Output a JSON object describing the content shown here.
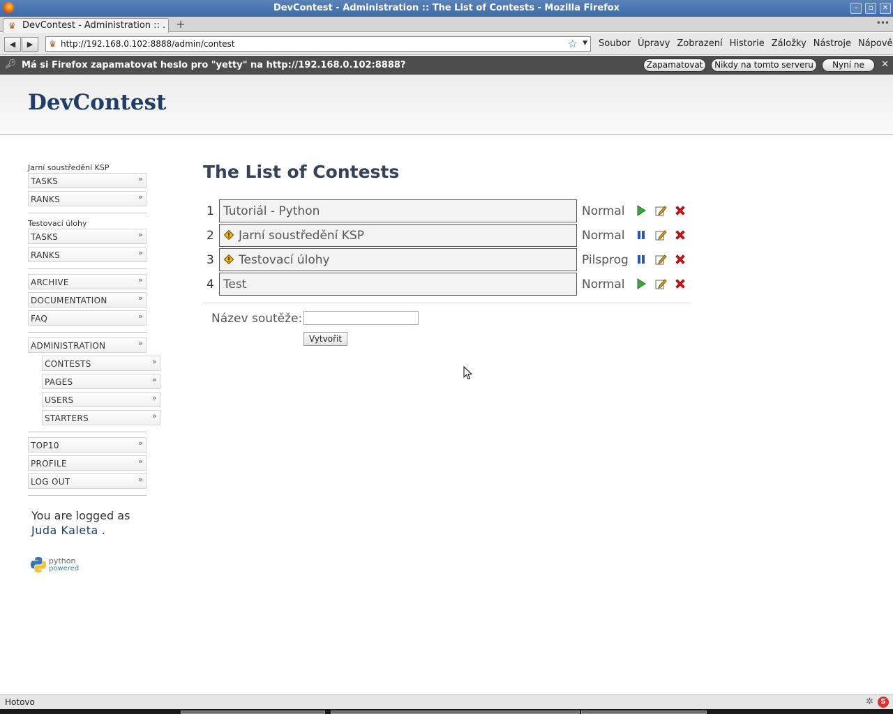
{
  "window": {
    "title": "DevContest - Administration :: The List of Contests - Mozilla Firefox",
    "buttons": [
      "–",
      "▫",
      "✕"
    ]
  },
  "tabs": {
    "active_label": "DevContest - Administration :: ...",
    "new_tab": "+",
    "list_icon": "•••"
  },
  "navbar": {
    "back_icon": "back-arrow-icon",
    "forward_icon": "forward-arrow-icon",
    "back": "◀",
    "forward": "▶",
    "url": "http://192.168.0.102:8888/admin/contest",
    "bookmark_star": "☆",
    "dropdown": "▼",
    "menu": [
      "Soubor",
      "Úpravy",
      "Zobrazení",
      "Historie",
      "Záložky",
      "Nástroje",
      "Nápověda"
    ]
  },
  "notification": {
    "message": "Má si Firefox zapamatovat heslo pro \"yetty\" na http://192.168.0.102:8888?",
    "remember": "Zapamatovat",
    "never": "Nikdy na tomto serveru",
    "not_now": "Nyní ne",
    "close": "✕"
  },
  "header": {
    "logo": "DevContest"
  },
  "sidebar": {
    "group1_title": "Jarní soustředění KSP",
    "group1_items": [
      "TASKS",
      "RANKS"
    ],
    "group2_title": "Testovací úlohy",
    "group2_items": [
      "TASKS",
      "RANKS"
    ],
    "group3_items": [
      "ARCHIVE",
      "DOCUMENTATION",
      "FAQ"
    ],
    "admin_item": "ADMINISTRATION",
    "admin_subitems": [
      "CONTESTS",
      "PAGES",
      "USERS",
      "STARTERS"
    ],
    "group5_items": [
      "TOP10",
      "PROFILE",
      "LOG OUT"
    ],
    "chevron": "»",
    "logged_text": "You are logged as",
    "logged_user": "Juda Kaleta",
    "logged_end": " .",
    "python_text1": "python",
    "python_text2": "powered"
  },
  "main": {
    "title": "The List of Contests",
    "contests": [
      {
        "num": "1",
        "name": "Tutoriál - Python",
        "type": "Normal",
        "has_warn": false,
        "state": "play"
      },
      {
        "num": "2",
        "name": "Jarní soustředění KSP",
        "type": "Normal",
        "has_warn": true,
        "state": "pause"
      },
      {
        "num": "3",
        "name": "Testovací úlohy",
        "type": "Pilsprog",
        "has_warn": true,
        "state": "pause"
      },
      {
        "num": "4",
        "name": "Test",
        "type": "Normal",
        "has_warn": false,
        "state": "play"
      }
    ],
    "new_label": "Název soutěže:",
    "new_value": "",
    "create_button": "Vytvořit"
  },
  "statusbar": {
    "text": "Hotovo"
  },
  "colors": {
    "accent": "#1f3d66",
    "play": "#3aa83a",
    "pause": "#2b55a6",
    "delete": "#d41a1a"
  }
}
